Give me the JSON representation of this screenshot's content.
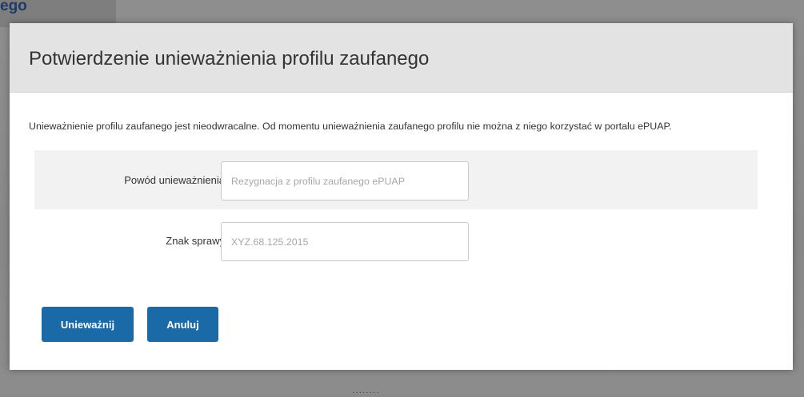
{
  "background": {
    "fragment_text": "ego",
    "bottom_text": "········"
  },
  "modal": {
    "title": "Potwierdzenie unieważnienia profilu zaufanego",
    "description": "Unieważnienie profilu zaufanego jest nieodwracalne. Od momentu unieważnienia zaufanego profilu nie można z niego korzystać w portalu ePUAP.",
    "fields": [
      {
        "label": "Powód unieważnienia",
        "value": "",
        "placeholder": "Rezygnacja z profilu zaufanego ePUAP"
      },
      {
        "label": "Znak sprawy",
        "value": "",
        "placeholder": "XYZ.68.125.2015"
      }
    ],
    "buttons": {
      "primary": "Unieważnij",
      "secondary": "Anuluj"
    }
  },
  "colors": {
    "header_bg": "#e3e3e3",
    "button_bg": "#1b6aa8",
    "shaded_row_bg": "#f2f2f2"
  }
}
